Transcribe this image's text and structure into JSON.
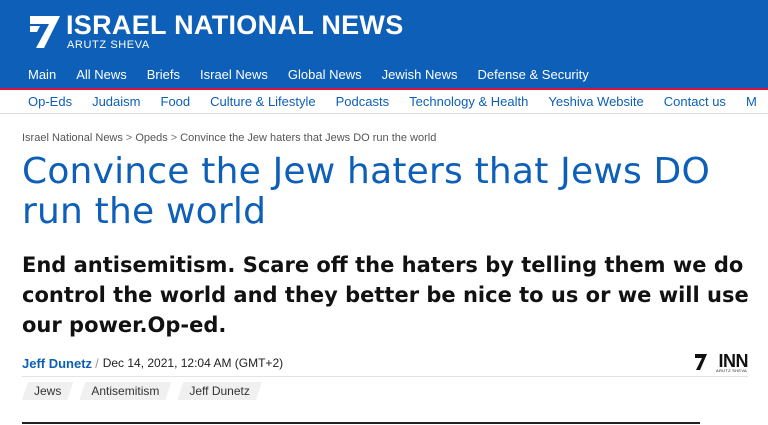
{
  "brand": {
    "title": "ISRAEL NATIONAL NEWS",
    "subtitle": "ARUTZ SHEVA",
    "primary_color": "#0d5fb8",
    "accent_color": "#d9153b"
  },
  "nav_main": [
    {
      "label": "Main"
    },
    {
      "label": "All News"
    },
    {
      "label": "Briefs"
    },
    {
      "label": "Israel News"
    },
    {
      "label": "Global News"
    },
    {
      "label": "Jewish News"
    },
    {
      "label": "Defense & Security"
    }
  ],
  "nav_sub": [
    {
      "label": "Op-Eds"
    },
    {
      "label": "Judaism"
    },
    {
      "label": "Food"
    },
    {
      "label": "Culture & Lifestyle"
    },
    {
      "label": "Podcasts"
    },
    {
      "label": "Technology & Health"
    },
    {
      "label": "Yeshiva Website"
    },
    {
      "label": "Contact us"
    },
    {
      "label": "M"
    }
  ],
  "breadcrumb": {
    "home": "Israel National News",
    "section": "Opeds",
    "current": "Convince the Jew haters that Jews DO run the world",
    "separator": ">"
  },
  "article": {
    "headline": "Convince the Jew haters that Jews DO run the world",
    "deck": "End antisemitism. Scare off the haters by telling them we do control the world and they better be nice to us or we will use our power.Op-ed.",
    "author": "Jeff Dunetz",
    "byline_separator": "/",
    "date": "Dec 14, 2021, 12:04 AM (GMT+2)",
    "tags": [
      {
        "label": "Jews"
      },
      {
        "label": "Antisemitism"
      },
      {
        "label": "Jeff Dunetz"
      }
    ]
  },
  "inn_logo": {
    "text": "INN",
    "subtext": "ARUTZ SHEVA",
    "icon": "inn-seven-icon"
  }
}
